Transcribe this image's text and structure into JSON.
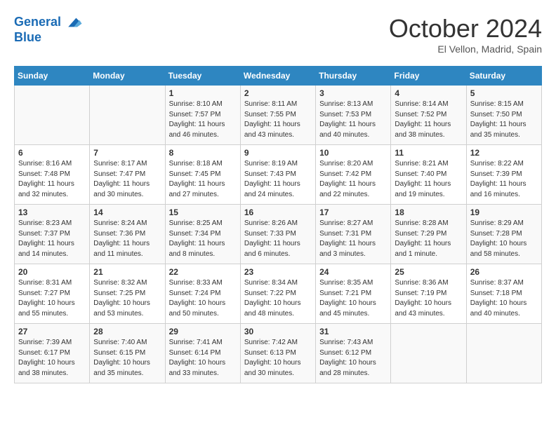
{
  "header": {
    "logo_line1": "General",
    "logo_line2": "Blue",
    "month": "October 2024",
    "location": "El Vellon, Madrid, Spain"
  },
  "weekdays": [
    "Sunday",
    "Monday",
    "Tuesday",
    "Wednesday",
    "Thursday",
    "Friday",
    "Saturday"
  ],
  "weeks": [
    [
      {
        "day": "",
        "info": ""
      },
      {
        "day": "",
        "info": ""
      },
      {
        "day": "1",
        "info": "Sunrise: 8:10 AM\nSunset: 7:57 PM\nDaylight: 11 hours and 46 minutes."
      },
      {
        "day": "2",
        "info": "Sunrise: 8:11 AM\nSunset: 7:55 PM\nDaylight: 11 hours and 43 minutes."
      },
      {
        "day": "3",
        "info": "Sunrise: 8:13 AM\nSunset: 7:53 PM\nDaylight: 11 hours and 40 minutes."
      },
      {
        "day": "4",
        "info": "Sunrise: 8:14 AM\nSunset: 7:52 PM\nDaylight: 11 hours and 38 minutes."
      },
      {
        "day": "5",
        "info": "Sunrise: 8:15 AM\nSunset: 7:50 PM\nDaylight: 11 hours and 35 minutes."
      }
    ],
    [
      {
        "day": "6",
        "info": "Sunrise: 8:16 AM\nSunset: 7:48 PM\nDaylight: 11 hours and 32 minutes."
      },
      {
        "day": "7",
        "info": "Sunrise: 8:17 AM\nSunset: 7:47 PM\nDaylight: 11 hours and 30 minutes."
      },
      {
        "day": "8",
        "info": "Sunrise: 8:18 AM\nSunset: 7:45 PM\nDaylight: 11 hours and 27 minutes."
      },
      {
        "day": "9",
        "info": "Sunrise: 8:19 AM\nSunset: 7:43 PM\nDaylight: 11 hours and 24 minutes."
      },
      {
        "day": "10",
        "info": "Sunrise: 8:20 AM\nSunset: 7:42 PM\nDaylight: 11 hours and 22 minutes."
      },
      {
        "day": "11",
        "info": "Sunrise: 8:21 AM\nSunset: 7:40 PM\nDaylight: 11 hours and 19 minutes."
      },
      {
        "day": "12",
        "info": "Sunrise: 8:22 AM\nSunset: 7:39 PM\nDaylight: 11 hours and 16 minutes."
      }
    ],
    [
      {
        "day": "13",
        "info": "Sunrise: 8:23 AM\nSunset: 7:37 PM\nDaylight: 11 hours and 14 minutes."
      },
      {
        "day": "14",
        "info": "Sunrise: 8:24 AM\nSunset: 7:36 PM\nDaylight: 11 hours and 11 minutes."
      },
      {
        "day": "15",
        "info": "Sunrise: 8:25 AM\nSunset: 7:34 PM\nDaylight: 11 hours and 8 minutes."
      },
      {
        "day": "16",
        "info": "Sunrise: 8:26 AM\nSunset: 7:33 PM\nDaylight: 11 hours and 6 minutes."
      },
      {
        "day": "17",
        "info": "Sunrise: 8:27 AM\nSunset: 7:31 PM\nDaylight: 11 hours and 3 minutes."
      },
      {
        "day": "18",
        "info": "Sunrise: 8:28 AM\nSunset: 7:29 PM\nDaylight: 11 hours and 1 minute."
      },
      {
        "day": "19",
        "info": "Sunrise: 8:29 AM\nSunset: 7:28 PM\nDaylight: 10 hours and 58 minutes."
      }
    ],
    [
      {
        "day": "20",
        "info": "Sunrise: 8:31 AM\nSunset: 7:27 PM\nDaylight: 10 hours and 55 minutes."
      },
      {
        "day": "21",
        "info": "Sunrise: 8:32 AM\nSunset: 7:25 PM\nDaylight: 10 hours and 53 minutes."
      },
      {
        "day": "22",
        "info": "Sunrise: 8:33 AM\nSunset: 7:24 PM\nDaylight: 10 hours and 50 minutes."
      },
      {
        "day": "23",
        "info": "Sunrise: 8:34 AM\nSunset: 7:22 PM\nDaylight: 10 hours and 48 minutes."
      },
      {
        "day": "24",
        "info": "Sunrise: 8:35 AM\nSunset: 7:21 PM\nDaylight: 10 hours and 45 minutes."
      },
      {
        "day": "25",
        "info": "Sunrise: 8:36 AM\nSunset: 7:19 PM\nDaylight: 10 hours and 43 minutes."
      },
      {
        "day": "26",
        "info": "Sunrise: 8:37 AM\nSunset: 7:18 PM\nDaylight: 10 hours and 40 minutes."
      }
    ],
    [
      {
        "day": "27",
        "info": "Sunrise: 7:39 AM\nSunset: 6:17 PM\nDaylight: 10 hours and 38 minutes."
      },
      {
        "day": "28",
        "info": "Sunrise: 7:40 AM\nSunset: 6:15 PM\nDaylight: 10 hours and 35 minutes."
      },
      {
        "day": "29",
        "info": "Sunrise: 7:41 AM\nSunset: 6:14 PM\nDaylight: 10 hours and 33 minutes."
      },
      {
        "day": "30",
        "info": "Sunrise: 7:42 AM\nSunset: 6:13 PM\nDaylight: 10 hours and 30 minutes."
      },
      {
        "day": "31",
        "info": "Sunrise: 7:43 AM\nSunset: 6:12 PM\nDaylight: 10 hours and 28 minutes."
      },
      {
        "day": "",
        "info": ""
      },
      {
        "day": "",
        "info": ""
      }
    ]
  ]
}
